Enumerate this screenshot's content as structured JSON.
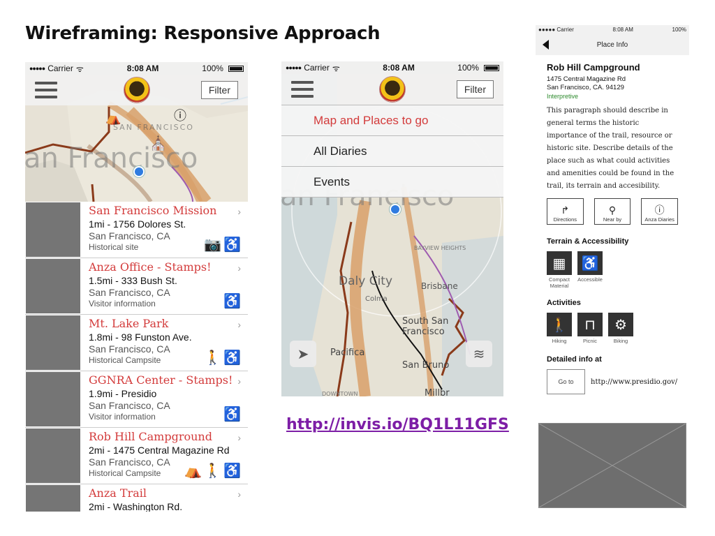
{
  "slide": {
    "title": "Wireframing: Responsive Approach",
    "link": "http://invis.io/BQ1L11GFS"
  },
  "status": {
    "carrier": "Carrier",
    "time": "8:08 AM",
    "battery": "100%"
  },
  "phone1": {
    "filter_label": "Filter",
    "map_label_big": "an Francisco",
    "map_label_small": "SAN FRANCISCO",
    "list": [
      {
        "title": "San Francisco Mission",
        "dist": "1mi - 1756 Dolores St.",
        "city": "San Francisco, CA",
        "type": "Historical site",
        "icons": [
          "camera-icon",
          "accessible-icon"
        ]
      },
      {
        "title": "Anza Office - Stamps!",
        "dist": "1.5mi - 333 Bush St.",
        "city": "San Francisco, CA",
        "type": "Visitor information",
        "icons": [
          "accessible-icon"
        ]
      },
      {
        "title": "Mt. Lake Park",
        "dist": "1.8mi - 98 Funston Ave.",
        "city": "San Francisco, CA",
        "type": "Historical Campsite",
        "icons": [
          "hiking-icon",
          "accessible-icon"
        ]
      },
      {
        "title": "GGNRA Center - Stamps!",
        "dist": "1.9mi - Presidio",
        "city": "San Francisco, CA",
        "type": "Visitor information",
        "icons": [
          "accessible-icon"
        ]
      },
      {
        "title": "Rob Hill Campground",
        "dist": "2mi - 1475 Central Magazine Rd",
        "city": "San Francisco, CA",
        "type": "Historical Campsite",
        "icons": [
          "tent-icon",
          "hiking-icon",
          "accessible-icon"
        ]
      },
      {
        "title": "Anza Trail",
        "dist": "2mi - Washington Rd."
      }
    ]
  },
  "phone2": {
    "filter_label": "Filter",
    "menu": [
      "Map and Places to go",
      "All Diaries",
      "Events"
    ],
    "map_labels": {
      "sf": "an Francisco",
      "bayview": "BAYVIEW HEIGHTS",
      "daly_city": "Daly City",
      "colma": "Colma",
      "brisbane": "Brisbane",
      "south_sf": "South San Francisco",
      "pacifica": "Pacifica",
      "san_bruno": "San Bruno",
      "downtown": "DOWNTOWN",
      "millbrae": "Millbr"
    }
  },
  "place_info": {
    "status_carrier": "Carrier",
    "status_time": "8:08 AM",
    "status_battery": "100%",
    "nav_title": "Place Info",
    "title": "Rob Hill Campground",
    "address1": "1475 Central Magazine Rd",
    "address2": "San Francisco, CA. 94129",
    "category": "Interpretive",
    "paragraph": "This paragraph should describe in general terms the historic importance of the trail, resource or historic site. Describe details of the place such as what could activities and amenities could be found in the trail, its terrain and accesibility.",
    "buttons": [
      {
        "label": "Directions",
        "icon": "directions-icon"
      },
      {
        "label": "Near by",
        "icon": "nearby-pins-icon"
      },
      {
        "label": "Anza Diaries",
        "icon": "info-icon"
      }
    ],
    "terrain_heading": "Terrain & Accessibility",
    "terrain": [
      {
        "label": "Compact Material",
        "icon": "grid-icon"
      },
      {
        "label": "Accessible",
        "icon": "accessible-icon"
      }
    ],
    "activities_heading": "Activities",
    "activities": [
      {
        "label": "Hiking",
        "icon": "hiking-icon"
      },
      {
        "label": "Picnic",
        "icon": "picnic-icon"
      },
      {
        "label": "Biking",
        "icon": "bike-icon"
      }
    ],
    "detailed_heading": "Detailed info at",
    "goto_label": "Go to",
    "url": "http://www.presidio.gov/"
  }
}
